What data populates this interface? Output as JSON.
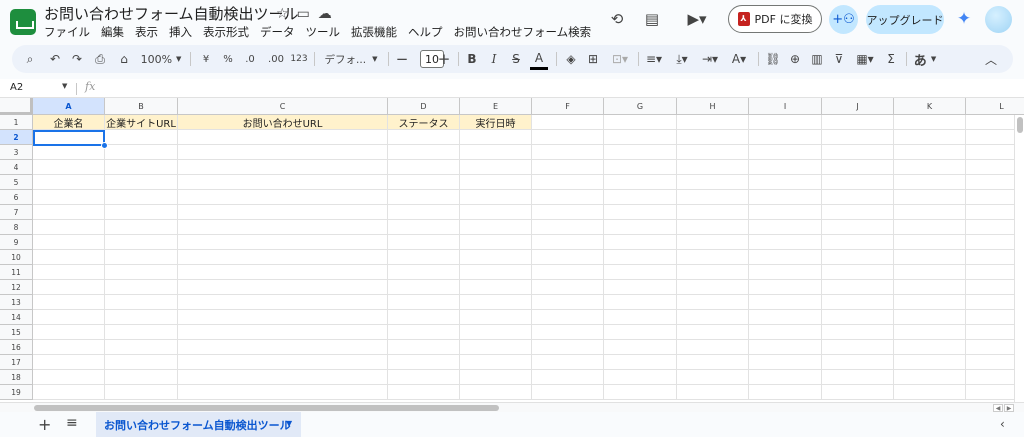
{
  "doc": {
    "title": "お問い合わせフォーム自動検出ツール",
    "title_icons": [
      "star-icon",
      "move-to-folder-icon",
      "cloud-saved-icon"
    ]
  },
  "menu": [
    "ファイル",
    "編集",
    "表示",
    "挿入",
    "表示形式",
    "データ",
    "ツール",
    "拡張機能",
    "ヘルプ",
    "お問い合わせフォーム検索"
  ],
  "header_right": {
    "pdf_label": "PDF に変換",
    "upgrade_label": "アップグレード",
    "icons": [
      "history-icon",
      "comment-icon",
      "meet-icon",
      "share-icon",
      "gemini-icon",
      "avatar"
    ]
  },
  "toolbar": {
    "zoom": "100%",
    "currency": "¥",
    "percent": "%",
    "decrease_decimal": ".0",
    "increase_decimal": ".00",
    "number_format": "123",
    "font": "デフォ...",
    "font_size": "10",
    "bold": "B",
    "italic": "I",
    "strikethrough": "S",
    "text_color": "A",
    "input_tools": "あ",
    "sum": "Σ"
  },
  "formula_bar": {
    "name_box": "A2",
    "fx": "fx"
  },
  "columns": [
    "A",
    "B",
    "C",
    "D",
    "E",
    "F",
    "G",
    "H",
    "I",
    "J",
    "K",
    "L"
  ],
  "rows": [
    "1",
    "2",
    "3",
    "4",
    "5",
    "6",
    "7",
    "8",
    "9",
    "10",
    "11",
    "12",
    "13",
    "14",
    "15",
    "16",
    "17",
    "18",
    "19"
  ],
  "header_row": [
    "企業名",
    "企業サイトURL",
    "お問い合わせURL",
    "ステータス",
    "実行日時"
  ],
  "selected_cell": "A2",
  "sheet_tab": "お問い合わせフォーム自動検出ツール",
  "colors": {
    "header_fill": "#fff2cc",
    "selection": "#1a73e8",
    "brand_green": "#1e8e3e"
  }
}
